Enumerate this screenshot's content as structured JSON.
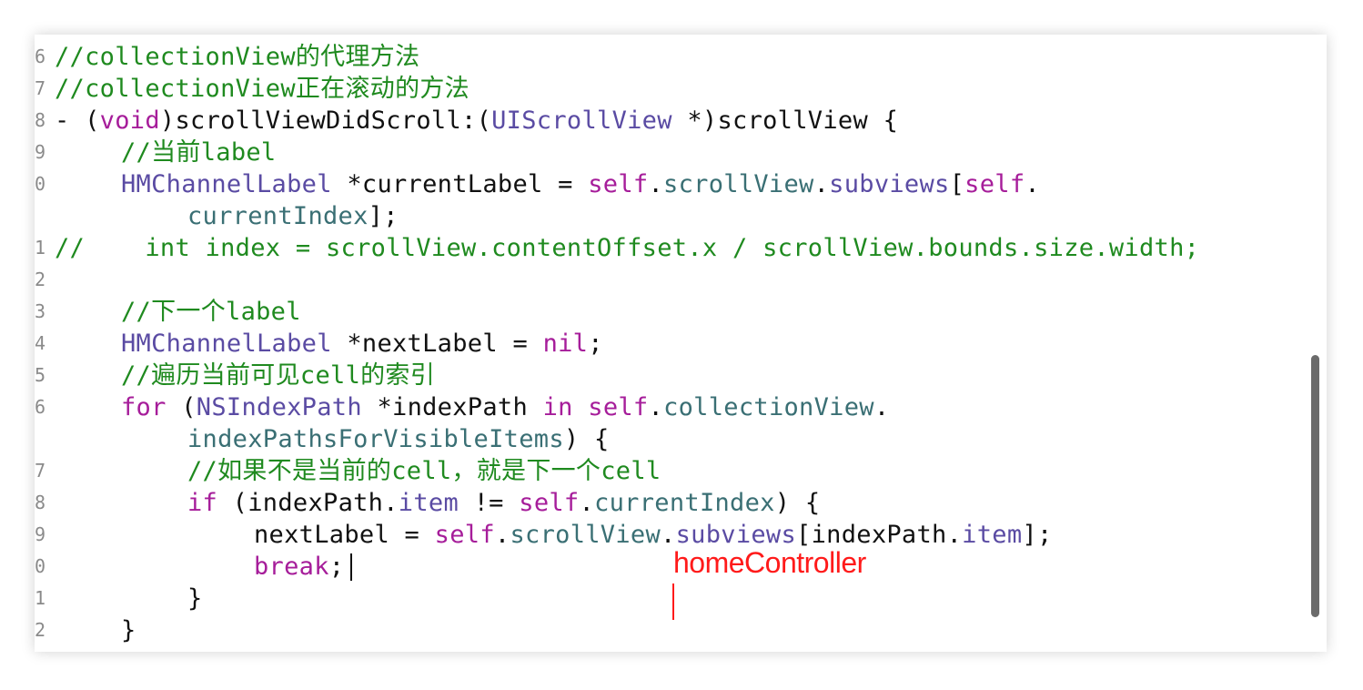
{
  "editor": {
    "gutter": [
      "6",
      "7",
      "8",
      "9",
      "0",
      "",
      "1",
      "2",
      "3",
      "4",
      "5",
      "6",
      "",
      "7",
      "8",
      "9",
      "0",
      "1",
      "2"
    ],
    "lines": [
      {
        "indent": 0,
        "parts": [
          {
            "c": "comment",
            "t": "//collectionView的代理方法"
          }
        ]
      },
      {
        "indent": 0,
        "parts": [
          {
            "c": "comment",
            "t": "//collectionView正在滚动的方法"
          }
        ]
      },
      {
        "indent": 0,
        "parts": [
          {
            "c": "plain",
            "t": "- ("
          },
          {
            "c": "kw",
            "t": "void"
          },
          {
            "c": "plain",
            "t": ")scrollViewDidScroll:("
          },
          {
            "c": "type",
            "t": "UIScrollView"
          },
          {
            "c": "plain",
            "t": " *)scrollView {"
          }
        ]
      },
      {
        "indent": 1,
        "parts": [
          {
            "c": "comment",
            "t": "//当前label"
          }
        ]
      },
      {
        "indent": 1,
        "parts": [
          {
            "c": "type",
            "t": "HMChannelLabel"
          },
          {
            "c": "plain",
            "t": " *currentLabel = "
          },
          {
            "c": "kw",
            "t": "self"
          },
          {
            "c": "plain",
            "t": "."
          },
          {
            "c": "prop",
            "t": "scrollView"
          },
          {
            "c": "plain",
            "t": "."
          },
          {
            "c": "type",
            "t": "subviews"
          },
          {
            "c": "plain",
            "t": "["
          },
          {
            "c": "kw",
            "t": "self"
          },
          {
            "c": "plain",
            "t": "."
          }
        ]
      },
      {
        "indent": 2,
        "parts": [
          {
            "c": "prop",
            "t": "currentIndex"
          },
          {
            "c": "plain",
            "t": "];"
          }
        ]
      },
      {
        "indent": 0,
        "parts": [
          {
            "c": "comment",
            "t": "//    int index = scrollView.contentOffset.x / scrollView.bounds.size.width;"
          }
        ]
      },
      {
        "indent": 0,
        "parts": []
      },
      {
        "indent": 1,
        "parts": [
          {
            "c": "comment",
            "t": "//下一个label"
          }
        ]
      },
      {
        "indent": 1,
        "parts": [
          {
            "c": "type",
            "t": "HMChannelLabel"
          },
          {
            "c": "plain",
            "t": " *nextLabel = "
          },
          {
            "c": "kw",
            "t": "nil"
          },
          {
            "c": "plain",
            "t": ";"
          }
        ]
      },
      {
        "indent": 1,
        "parts": [
          {
            "c": "comment",
            "t": "//遍历当前可见cell的索引"
          }
        ]
      },
      {
        "indent": 1,
        "parts": [
          {
            "c": "kw",
            "t": "for"
          },
          {
            "c": "plain",
            "t": " ("
          },
          {
            "c": "type",
            "t": "NSIndexPath"
          },
          {
            "c": "plain",
            "t": " *indexPath "
          },
          {
            "c": "kw",
            "t": "in"
          },
          {
            "c": "plain",
            "t": " "
          },
          {
            "c": "kw",
            "t": "self"
          },
          {
            "c": "plain",
            "t": "."
          },
          {
            "c": "prop",
            "t": "collectionView"
          },
          {
            "c": "plain",
            "t": "."
          }
        ]
      },
      {
        "indent": 2,
        "parts": [
          {
            "c": "prop",
            "t": "indexPathsForVisibleItems"
          },
          {
            "c": "plain",
            "t": ") {"
          }
        ]
      },
      {
        "indent": 2,
        "parts": [
          {
            "c": "comment",
            "t": "//如果不是当前的cell，就是下一个cell"
          }
        ]
      },
      {
        "indent": 2,
        "parts": [
          {
            "c": "kw",
            "t": "if"
          },
          {
            "c": "plain",
            "t": " (indexPath."
          },
          {
            "c": "type",
            "t": "item"
          },
          {
            "c": "plain",
            "t": " != "
          },
          {
            "c": "kw",
            "t": "self"
          },
          {
            "c": "plain",
            "t": "."
          },
          {
            "c": "prop",
            "t": "currentIndex"
          },
          {
            "c": "plain",
            "t": ") {"
          }
        ]
      },
      {
        "indent": 3,
        "parts": [
          {
            "c": "plain",
            "t": "nextLabel = "
          },
          {
            "c": "kw",
            "t": "self"
          },
          {
            "c": "plain",
            "t": "."
          },
          {
            "c": "prop",
            "t": "scrollView"
          },
          {
            "c": "plain",
            "t": "."
          },
          {
            "c": "type",
            "t": "subviews"
          },
          {
            "c": "plain",
            "t": "[indexPath."
          },
          {
            "c": "type",
            "t": "item"
          },
          {
            "c": "plain",
            "t": "];"
          }
        ]
      },
      {
        "indent": 3,
        "parts": [
          {
            "c": "kw",
            "t": "break"
          },
          {
            "c": "plain",
            "t": ";"
          }
        ]
      },
      {
        "indent": 2,
        "parts": [
          {
            "c": "plain",
            "t": "}"
          }
        ]
      },
      {
        "indent": 1,
        "parts": [
          {
            "c": "plain",
            "t": "}"
          }
        ]
      }
    ]
  },
  "overlay": {
    "label": "homeController"
  },
  "colors": {
    "comment": "#1f8a1f",
    "keyword": "#a61d9a",
    "type": "#5a4ba3",
    "property": "#3a6f74",
    "overlay": "#ff1a1a"
  }
}
